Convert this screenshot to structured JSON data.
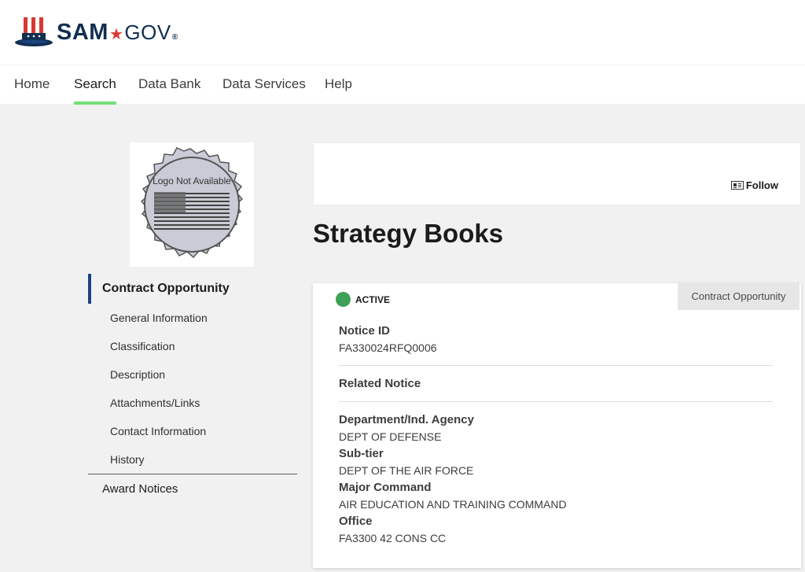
{
  "brand": {
    "name": "SAM",
    "gov": "GOV"
  },
  "nav": {
    "items": [
      {
        "label": "Home"
      },
      {
        "label": "Search",
        "active": true
      },
      {
        "label": "Data Bank"
      },
      {
        "label": "Data Services"
      },
      {
        "label": "Help"
      }
    ]
  },
  "seal": {
    "text": "Logo Not Available"
  },
  "sidebar": {
    "main": "Contract Opportunity",
    "sub": [
      "General Information",
      "Classification",
      "Description",
      "Attachments/Links",
      "Contact Information",
      "History"
    ],
    "bottom": "Award Notices"
  },
  "follow": {
    "label": "Follow"
  },
  "page_title": "Strategy Books",
  "card": {
    "status": "ACTIVE",
    "status_color": "#3ea056",
    "type": "Contract Opportunity",
    "notice_id_label": "Notice ID",
    "notice_id": "FA330024RFQ0006",
    "related_notice_label": "Related Notice",
    "department_label": "Department/Ind. Agency",
    "department": "DEPT OF DEFENSE",
    "subtier_label": "Sub-tier",
    "subtier": "DEPT OF THE AIR FORCE",
    "command_label": "Major Command",
    "command": "AIR EDUCATION AND TRAINING COMMAND",
    "office_label": "Office",
    "office": "FA3300 42 CONS CC"
  },
  "colors": {
    "nav_active": "#70e17b",
    "sidebar_active": "#1a4480",
    "brand": "#112e51"
  }
}
